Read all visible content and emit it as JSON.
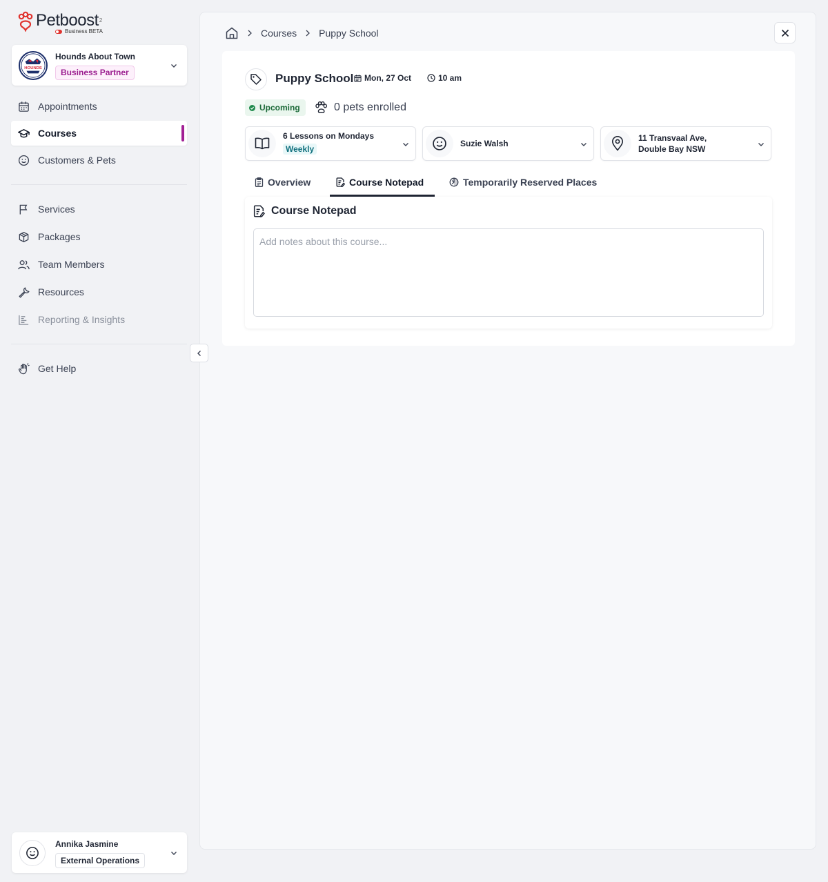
{
  "brand": {
    "name": "Petboost",
    "superscript": "2",
    "subtitle": "Business BETA",
    "accent": "#e0342f"
  },
  "business": {
    "name": "Hounds About Town",
    "badge": "Business Partner",
    "logo_text": "HOUNDS",
    "badge_color": "#9b1d8f"
  },
  "nav": {
    "primary": [
      {
        "label": "Appointments",
        "icon": "calendar-icon"
      },
      {
        "label": "Courses",
        "icon": "graduation-cap-icon",
        "active": true
      },
      {
        "label": "Customers & Pets",
        "icon": "smile-icon"
      }
    ],
    "secondary": [
      {
        "label": "Services",
        "icon": "flag-icon"
      },
      {
        "label": "Packages",
        "icon": "package-icon"
      },
      {
        "label": "Team Members",
        "icon": "users-icon"
      },
      {
        "label": "Resources",
        "icon": "wrench-icon"
      },
      {
        "label": "Reporting & Insights",
        "icon": "chart-icon",
        "disabled": true
      }
    ],
    "help": {
      "label": "Get Help",
      "icon": "hand-icon"
    }
  },
  "user": {
    "name": "Annika Jasmine",
    "role": "External Operations"
  },
  "breadcrumb": {
    "home_icon": "home-icon",
    "items": [
      "Courses",
      "Puppy School"
    ]
  },
  "course": {
    "title": "Puppy School",
    "date": "Mon, 27 Oct",
    "time": "10 am",
    "status": "Upcoming",
    "status_color": "#1f8a4c",
    "enrolled": "0 pets enrolled",
    "schedule": {
      "label": "6 Lessons on Mondays",
      "frequency": "Weekly"
    },
    "instructor": "Suzie Walsh",
    "location": {
      "line1": "11 Transvaal Ave,",
      "line2": "Double Bay NSW"
    }
  },
  "tabs": [
    {
      "label": "Overview",
      "icon": "clipboard-icon"
    },
    {
      "label": "Course Notepad",
      "icon": "notepad-icon",
      "active": true
    },
    {
      "label": "Temporarily Reserved Places",
      "icon": "timer-icon"
    }
  ],
  "notepad": {
    "title": "Course Notepad",
    "value": "",
    "placeholder": "Add notes about this course..."
  }
}
